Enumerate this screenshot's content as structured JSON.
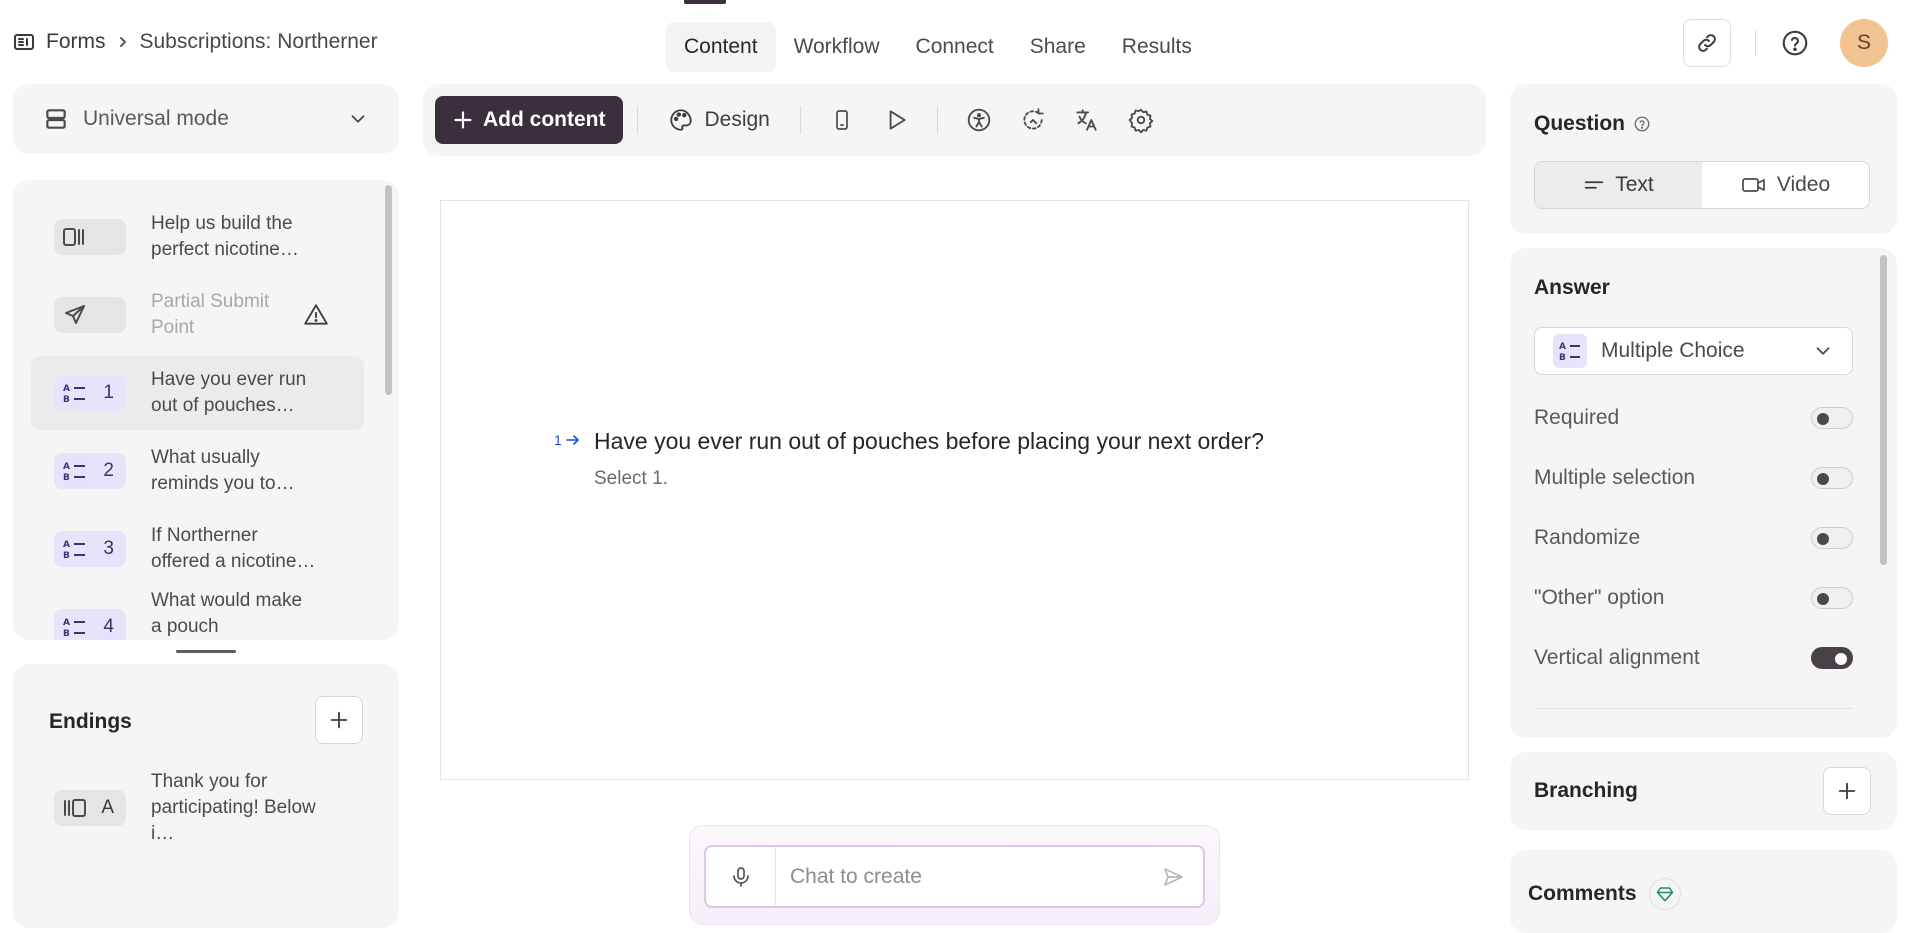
{
  "breadcrumb": {
    "root": "Forms",
    "current": "Subscriptions: Northerner"
  },
  "tabs": [
    {
      "label": "Content",
      "active": true
    },
    {
      "label": "Workflow"
    },
    {
      "label": "Connect"
    },
    {
      "label": "Share"
    },
    {
      "label": "Results"
    }
  ],
  "user": {
    "avatar_initial": "S"
  },
  "mode": {
    "label": "Universal mode"
  },
  "toolbar": {
    "add_label": "Add content",
    "design_label": "Design"
  },
  "questions": [
    {
      "icon": "statement-icon",
      "num": "",
      "text": "Help us build the perfect nicotine…",
      "style": "gray"
    },
    {
      "icon": "partial-submit-icon",
      "num": "",
      "text": "Partial Submit Point",
      "style": "gray",
      "faded": true,
      "warning": true
    },
    {
      "icon": "multiple-choice-icon",
      "num": "1",
      "text": "Have you ever run out of pouches…",
      "style": "purple",
      "selected": true
    },
    {
      "icon": "multiple-choice-icon",
      "num": "2",
      "text": "What usually reminds you to…",
      "style": "purple"
    },
    {
      "icon": "multiple-choice-icon",
      "num": "3",
      "text": "If Northerner offered a nicotine…",
      "style": "purple"
    },
    {
      "icon": "multiple-choice-icon",
      "num": "4",
      "text": "What would make a pouch subscription…",
      "style": "purple"
    }
  ],
  "endings": {
    "title": "Endings",
    "items": [
      {
        "letter": "A",
        "text": "Thank you for participating! Below i…"
      }
    ]
  },
  "canvas": {
    "number": "1",
    "question": "Have you ever run out of pouches before placing your next order?",
    "hint": "Select 1."
  },
  "chat": {
    "placeholder": "Chat to create"
  },
  "question_panel": {
    "title": "Question",
    "text_label": "Text",
    "video_label": "Video"
  },
  "answer_panel": {
    "title": "Answer",
    "type": "Multiple Choice",
    "toggles": [
      {
        "label": "Required",
        "on": false
      },
      {
        "label": "Multiple selection",
        "on": false
      },
      {
        "label": "Randomize",
        "on": false
      },
      {
        "label": "\"Other\" option",
        "on": false
      },
      {
        "label": "Vertical alignment",
        "on": true
      }
    ]
  },
  "branching": {
    "title": "Branching"
  },
  "comments": {
    "title": "Comments"
  },
  "colors": {
    "primary_button": "#3b2f3d",
    "accent_purple": "#e9e2fb",
    "link_blue": "#1d4ed8"
  }
}
